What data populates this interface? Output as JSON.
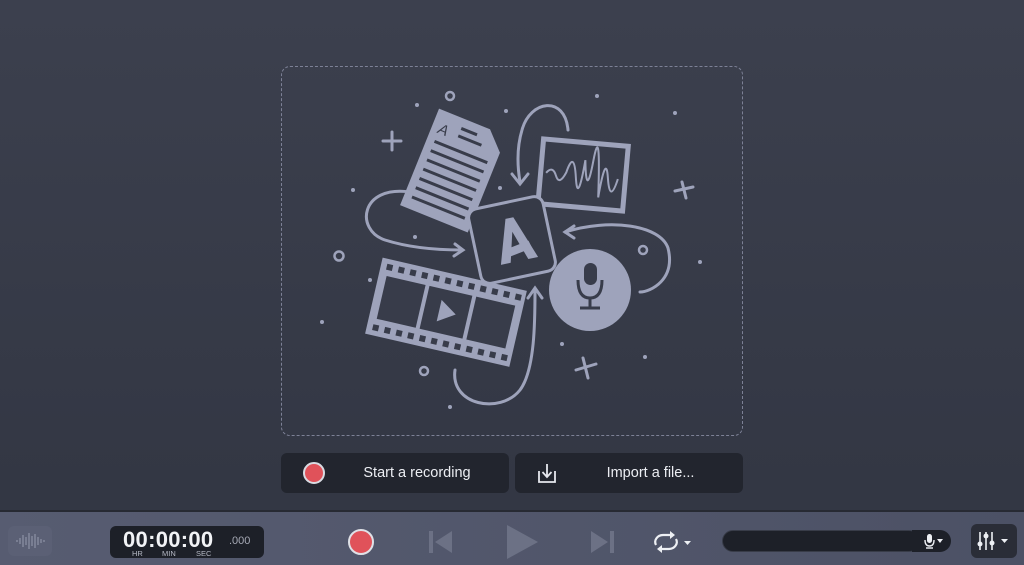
{
  "dropzone": {
    "illustration": "media-import-illustration",
    "logo_letter": "A",
    "doc_letter": "A"
  },
  "actions": {
    "start_recording": "Start a recording",
    "import_file": "Import a file..."
  },
  "toolbar": {
    "timer": {
      "value": "00:00:00",
      "ms": ".000",
      "hr": "HR",
      "min": "MIN",
      "sec": "SEC"
    },
    "icons": [
      "waveform-icon",
      "record-icon",
      "skip-back-icon",
      "play-icon",
      "skip-forward-icon",
      "loop-icon",
      "microphone-icon",
      "mixer-icon"
    ]
  },
  "colors": {
    "record": "#e0525a",
    "illustration": "#9ea3bb",
    "toolbar": "#50556a"
  }
}
